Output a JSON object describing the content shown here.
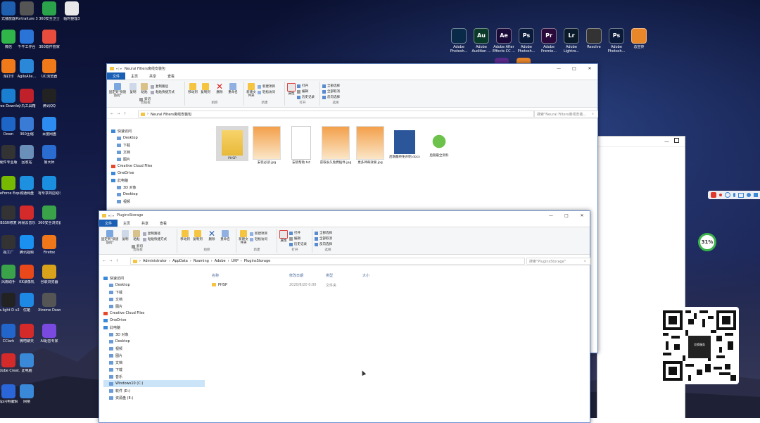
{
  "desktop": {
    "left_icons": [
      {
        "label": "式播放器",
        "color": "#1e5fb0"
      },
      {
        "label": "Portraiture 3",
        "color": "#555"
      },
      {
        "label": "360安全卫士",
        "color": "#2aa34a"
      },
      {
        "label": "临时整理3",
        "color": "#e8e8e8"
      },
      {
        "label": "微信",
        "color": "#2fb54a"
      },
      {
        "label": "千牛工作台",
        "color": "#2a74d8"
      },
      {
        "label": "360软件管家",
        "color": "#e84c3d"
      },
      {
        "label": "淘打印",
        "color": "#f07a1a"
      },
      {
        "label": "AgiloAlle...",
        "color": "#2b88d8"
      },
      {
        "label": "UC浏览器",
        "color": "#f07a1a"
      },
      {
        "label": "Free Downlo...",
        "color": "#1a7fd1"
      },
      {
        "label": "小丸工具箱",
        "color": "#c0202a"
      },
      {
        "label": "腾讯QQ",
        "color": "#222"
      },
      {
        "label": "Down",
        "color": "#1d66c7"
      },
      {
        "label": "360压缩",
        "color": "#3a7bd5"
      },
      {
        "label": "百度网盘",
        "color": "#2d8cf0"
      },
      {
        "label": "硬件专业版",
        "color": "#333"
      },
      {
        "label": "回收站",
        "color": "#6a8fb8"
      },
      {
        "label": "鲁大师",
        "color": "#2a6cd0"
      },
      {
        "label": "GeForce Experience",
        "color": "#76b900"
      },
      {
        "label": "城通网盘",
        "color": "#1e90e0"
      },
      {
        "label": "有专享商店助手",
        "color": "#1a8fe0"
      },
      {
        "label": "BSSN修复",
        "color": "#333"
      },
      {
        "label": "网易云音乐",
        "color": "#d42a2a"
      },
      {
        "label": "360安全浏览器",
        "color": "#3aa34a"
      },
      {
        "label": "视工厂",
        "color": "#333"
      },
      {
        "label": "腾讯视频",
        "color": "#1a90f0"
      },
      {
        "label": "Firefox",
        "color": "#f0761a"
      },
      {
        "label": "风雨助手",
        "color": "#3aa34a"
      },
      {
        "label": "KK录像机",
        "color": "#e8481a"
      },
      {
        "label": "谷歌浏览器",
        "color": "#d8a21a"
      },
      {
        "label": "La.light D v2.5",
        "color": "#222"
      },
      {
        "label": "优酷",
        "color": "#1e88e5"
      },
      {
        "label": "Xtreme Downlo...",
        "color": "#555"
      },
      {
        "label": "CClark",
        "color": "#2266cc"
      },
      {
        "label": "微吧聊天",
        "color": "#d42a2a"
      },
      {
        "label": "AI配音专家",
        "color": "#7a4ae0"
      },
      {
        "label": "Adobe Creat...",
        "color": "#d42a2a"
      },
      {
        "label": "此电脑",
        "color": "#3a88d8"
      },
      {
        "label": "Sp闪电编辑",
        "color": "#2a66d8"
      },
      {
        "label": "网络",
        "color": "#3a88d8"
      }
    ],
    "right_icons": [
      {
        "label": "Adobe Photosh...",
        "abbr": "",
        "color": "#0a2a4a"
      },
      {
        "label": "Adobe Audition ...",
        "abbr": "Au",
        "color": "#0a3a2a"
      },
      {
        "label": "Adobe After Effects CC ...",
        "abbr": "Ae",
        "color": "#1a0a3a"
      },
      {
        "label": "Adobe Photosh...",
        "abbr": "Ps",
        "color": "#0a1a3a"
      },
      {
        "label": "Adobe Premie...",
        "abbr": "Pr",
        "color": "#2a0a3a"
      },
      {
        "label": "Adobe Lightro...",
        "abbr": "Lr",
        "color": "#0a1a2a"
      },
      {
        "label": "Resolve",
        "abbr": "",
        "color": "#333"
      },
      {
        "label": "Adobe Photosh...",
        "abbr": "Ps",
        "color": "#0a1a3a"
      },
      {
        "label": "总宣传",
        "abbr": "",
        "color": "#e8862a"
      }
    ],
    "tray": {
      "percent": "31%"
    },
    "qr_label": "交换服务"
  },
  "window_top": {
    "title": "Neural Filters离线安装包",
    "tabs": [
      "文件",
      "主页",
      "共享",
      "查看"
    ],
    "path": "Neural Filters离线安装包",
    "search_placeholder": "搜索\"Neural Filters离线安装...",
    "files": [
      {
        "name": "PHSP",
        "type": "folder"
      },
      {
        "name": "安装必读.jpg",
        "type": "image"
      },
      {
        "name": "安装帮助.txt",
        "type": "text"
      },
      {
        "name": "获取永久免费插件.jpg",
        "type": "image"
      },
      {
        "name": "更多神奇效果.jpg",
        "type": "image"
      },
      {
        "name": "后期最终免声明.docx",
        "type": "word"
      },
      {
        "name": "后期最全资料",
        "type": "shortcut"
      }
    ]
  },
  "ribbon": {
    "clipboard": {
      "pin": "固定到\"快速访问\"",
      "copy": "复制",
      "paste": "粘贴",
      "cut": "剪切",
      "copypath": "复制路径",
      "pasteshortcut": "粘贴快捷方式",
      "name": "剪贴板"
    },
    "organize": {
      "moveto": "移动到",
      "copyto": "复制到",
      "delete": "删除",
      "rename": "重命名",
      "name": "组织"
    },
    "new": {
      "newfolder": "新建文件夹",
      "newitem": "新建项目",
      "easyaccess": "轻松访问",
      "name": "新建"
    },
    "open": {
      "props": "属性",
      "open": "打开",
      "edit": "编辑",
      "history": "历史记录",
      "name": "打开"
    },
    "select": {
      "all": "全部选择",
      "none": "全部取消",
      "invert": "反向选择",
      "name": "选择"
    }
  },
  "side_top": [
    "快速访问",
    "Desktop",
    "下载",
    "文档",
    "图片",
    "Creative Cloud Files",
    "OneDrive",
    "此电脑",
    "3D 对象",
    "Desktop",
    "视频"
  ],
  "window_bottom": {
    "title": "PluginsStorage",
    "tabs": [
      "文件",
      "主页",
      "共享",
      "查看"
    ],
    "path": [
      "Administrator",
      "AppData",
      "Roaming",
      "Adobe",
      "UXP",
      "PluginsStorage"
    ],
    "search_placeholder": "搜索\"PluginsStorage\"",
    "columns": [
      "名称",
      "修改日期",
      "类型",
      "大小"
    ],
    "rows": [
      {
        "name": "PHSP",
        "date": "2020/8/20 0:00",
        "type": "文件夹",
        "size": ""
      }
    ],
    "side": [
      "快速访问",
      "Desktop",
      "下载",
      "文档",
      "图片",
      "Creative Cloud Files",
      "OneDrive",
      "此电脑",
      "3D 对象",
      "Desktop",
      "视频",
      "图片",
      "文档",
      "下载",
      "音乐",
      "Windows10 (C:)",
      "软件 (D:)",
      "资源盘 (E:)"
    ]
  },
  "colors": {
    "accent": "#1a5fb4",
    "folder": "#f5c542"
  }
}
